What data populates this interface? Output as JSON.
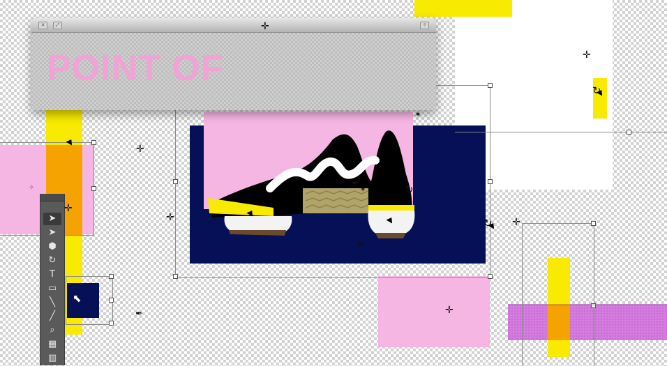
{
  "window": {
    "title_text": "POINT OF",
    "close_icon": "close-icon",
    "expand_icon": "expand-icon",
    "share_icon": "share-icon"
  },
  "toolbar": {
    "tools": [
      "selection-tool",
      "direct-selection-tool",
      "pen-tool",
      "lasso-tool",
      "type-tool",
      "rectangle-tool",
      "line-tool",
      "brush-tool",
      "zoom-tool",
      "gradient-tool",
      "graph-tool"
    ],
    "glyphs": [
      "➤",
      "➤",
      "⬢",
      "↻",
      "T",
      "▭",
      "╲",
      "╱",
      "⌕",
      "▦",
      "▥"
    ]
  },
  "canvas": {
    "subject": "sneaker illustration",
    "colors": {
      "pink": "#f6b6e3",
      "navy": "#061057",
      "yellow": "#f8ea00",
      "orange": "#f5a300",
      "purple": "#d57ce0"
    }
  }
}
